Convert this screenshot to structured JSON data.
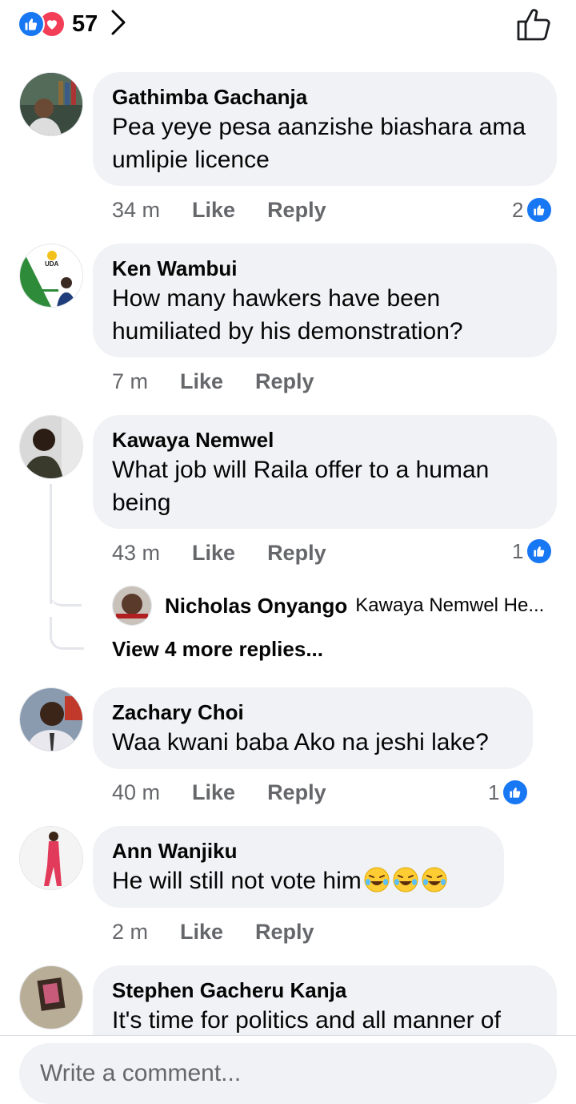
{
  "header": {
    "reaction_count": "57",
    "like_icon": "like-reaction-icon",
    "love_icon": "love-reaction-icon",
    "thumb_icon": "thumbs-up-outline-icon"
  },
  "actions": {
    "like": "Like",
    "reply": "Reply"
  },
  "comments": [
    {
      "name": "Gathimba Gachanja",
      "text": "Pea yeye pesa aanzishe biashara ama umlipie licence",
      "time": "34 m",
      "reactions": "2"
    },
    {
      "name": "Ken Wambui",
      "text": "How many hawkers have been humiliated by his demonstration?",
      "time": "7 m",
      "reactions": "",
      "avatar_text": "UDA"
    },
    {
      "name": "Kawaya Nemwel",
      "text": "What job will Raila offer to a human being",
      "time": "43 m",
      "reactions": "1"
    },
    {
      "name": "Zachary Choi",
      "text": "Waa kwani baba Ako na jeshi lake?",
      "time": "40 m",
      "reactions": "1"
    },
    {
      "name": "Ann Wanjiku",
      "text": "He will still not vote him",
      "time": "2 m",
      "reactions": ""
    },
    {
      "name": "Stephen Gacheru Kanja",
      "text": "It's time for politics and all manner of",
      "time": "",
      "reactions": ""
    }
  ],
  "reply_preview": {
    "name": "Nicholas Onyango",
    "text": "Kawaya Nemwel He...",
    "more": "View 4 more replies..."
  },
  "composer": {
    "placeholder": "Write a comment..."
  },
  "colors": {
    "accent": "#1877f2",
    "love": "#f33e58",
    "bubble": "#f0f2f5",
    "meta": "#65676b"
  }
}
